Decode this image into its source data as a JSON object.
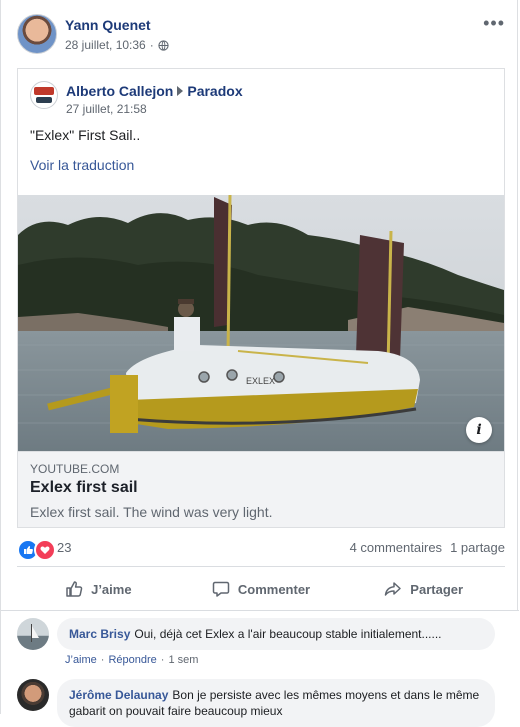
{
  "post": {
    "author": "Yann Quenet",
    "timestamp": "28 juillet, 10:36",
    "privacy_icon": "globe-icon",
    "more_icon": "more-options-icon"
  },
  "shared_post": {
    "author": "Alberto Callejon",
    "group": "Paradox",
    "timestamp": "27 juillet, 21:58",
    "text": "\"Exlex\" First Sail..",
    "translate_label": "Voir la traduction"
  },
  "link_preview": {
    "source": "YOUTUBE.COM",
    "title": "Exlex first sail",
    "description": "Exlex first sail. The wind was very light.",
    "info_label": "i",
    "hull_text": "EXLEX"
  },
  "reactions": {
    "count": "23",
    "comments": "4 commentaires",
    "shares": "1 partage",
    "like_color": "#1877f2",
    "love_color": "#f33e58"
  },
  "actions": {
    "like": "J’aime",
    "comment": "Commenter",
    "share": "Partager"
  },
  "comments": [
    {
      "author": "Marc Brisy",
      "text": "Oui, déjà cet Exlex a l'air beaucoup stable initialement......",
      "like_label": "J’aime",
      "reply_label": "Répondre",
      "time": "1 sem",
      "sep": "·"
    },
    {
      "author": "Jérôme Delaunay",
      "text": "Bon je persiste avec les mêmes moyens et dans le même gabarit on pouvait faire beaucoup mieux"
    }
  ]
}
